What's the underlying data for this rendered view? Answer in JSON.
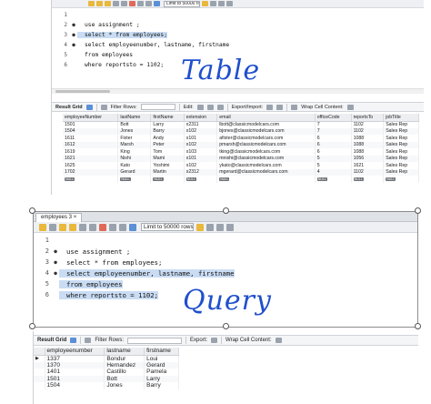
{
  "top_window": {
    "limit_label": "Limit to 50000 rows",
    "editor_lines": [
      {
        "num": "1",
        "code": ""
      },
      {
        "num": "2",
        "code": "use assignment ;"
      },
      {
        "num": "3",
        "code": "select * from employees;"
      },
      {
        "num": "4",
        "code": "select employeenumber, lastname, firstname"
      },
      {
        "num": "5",
        "code": "from employees"
      },
      {
        "num": "6",
        "code": "where reportsto = 1102;"
      }
    ],
    "annotation": "Table",
    "result_bar": {
      "title": "Result Grid",
      "filter_label": "Filter Rows:",
      "edit_label": "Edit:",
      "export_label": "Export/Import:",
      "wrap_label": "Wrap Cell Content:"
    },
    "columns": [
      "employeeNumber",
      "lastName",
      "firstName",
      "extension",
      "email",
      "officeCode",
      "reportsTo",
      "jobTitle"
    ],
    "rows": [
      [
        "1501",
        "Bott",
        "Larry",
        "x2311",
        "lbott@classicmodelcars.com",
        "7",
        "1102",
        "Sales Rep"
      ],
      [
        "1504",
        "Jones",
        "Barry",
        "x102",
        "bjones@classicmodelcars.com",
        "7",
        "1102",
        "Sales Rep"
      ],
      [
        "1611",
        "Fixter",
        "Andy",
        "x101",
        "afixter@classicmodelcars.com",
        "6",
        "1088",
        "Sales Rep"
      ],
      [
        "1612",
        "Marsh",
        "Peter",
        "x102",
        "pmarsh@classicmodelcars.com",
        "6",
        "1088",
        "Sales Rep"
      ],
      [
        "1619",
        "King",
        "Tom",
        "x103",
        "tking@classicmodelcars.com",
        "6",
        "1088",
        "Sales Rep"
      ],
      [
        "1621",
        "Nishi",
        "Mami",
        "x101",
        "mnishi@classicmodelcars.com",
        "5",
        "1056",
        "Sales Rep"
      ],
      [
        "1625",
        "Kato",
        "Yoshimi",
        "x102",
        "ykato@classicmodelcars.com",
        "5",
        "1621",
        "Sales Rep"
      ],
      [
        "1702",
        "Gerard",
        "Martin",
        "x2312",
        "mgerard@classicmodelcars.com",
        "4",
        "1102",
        "Sales Rep"
      ],
      [
        "NULL",
        "NULL",
        "NULL",
        "NULL",
        "NULL",
        "NULL",
        "NULL",
        "NULL"
      ]
    ]
  },
  "front_window": {
    "tab_label": "employees 3",
    "limit_label": "Limit to 50000 rows",
    "editor_lines": [
      {
        "num": "1",
        "code": ""
      },
      {
        "num": "2",
        "code": "use assignment ;"
      },
      {
        "num": "3",
        "code": "select * from employees;"
      },
      {
        "num": "4",
        "code": "select employeenumber, lastname, firstname"
      },
      {
        "num": "5",
        "code": "from employees"
      },
      {
        "num": "6",
        "code": "where reportsto = 1102;"
      }
    ],
    "annotation": "Query"
  },
  "bottom_grid": {
    "result_bar": {
      "title": "Result Grid",
      "filter_label": "Filter Rows:",
      "export_label": "Export:",
      "wrap_label": "Wrap Cell Content:"
    },
    "columns": [
      "employeenumber",
      "lastname",
      "firstname"
    ],
    "rows": [
      [
        "1337",
        "Bondur",
        "Loui"
      ],
      [
        "1370",
        "Hernandez",
        "Gerard"
      ],
      [
        "1401",
        "Castillo",
        "Pamela"
      ],
      [
        "1501",
        "Bott",
        "Larry"
      ],
      [
        "1504",
        "Jones",
        "Barry"
      ]
    ]
  },
  "colors": {
    "annotation_ink": "#1f4fcc",
    "selection_highlight": "#c9dcf3"
  }
}
